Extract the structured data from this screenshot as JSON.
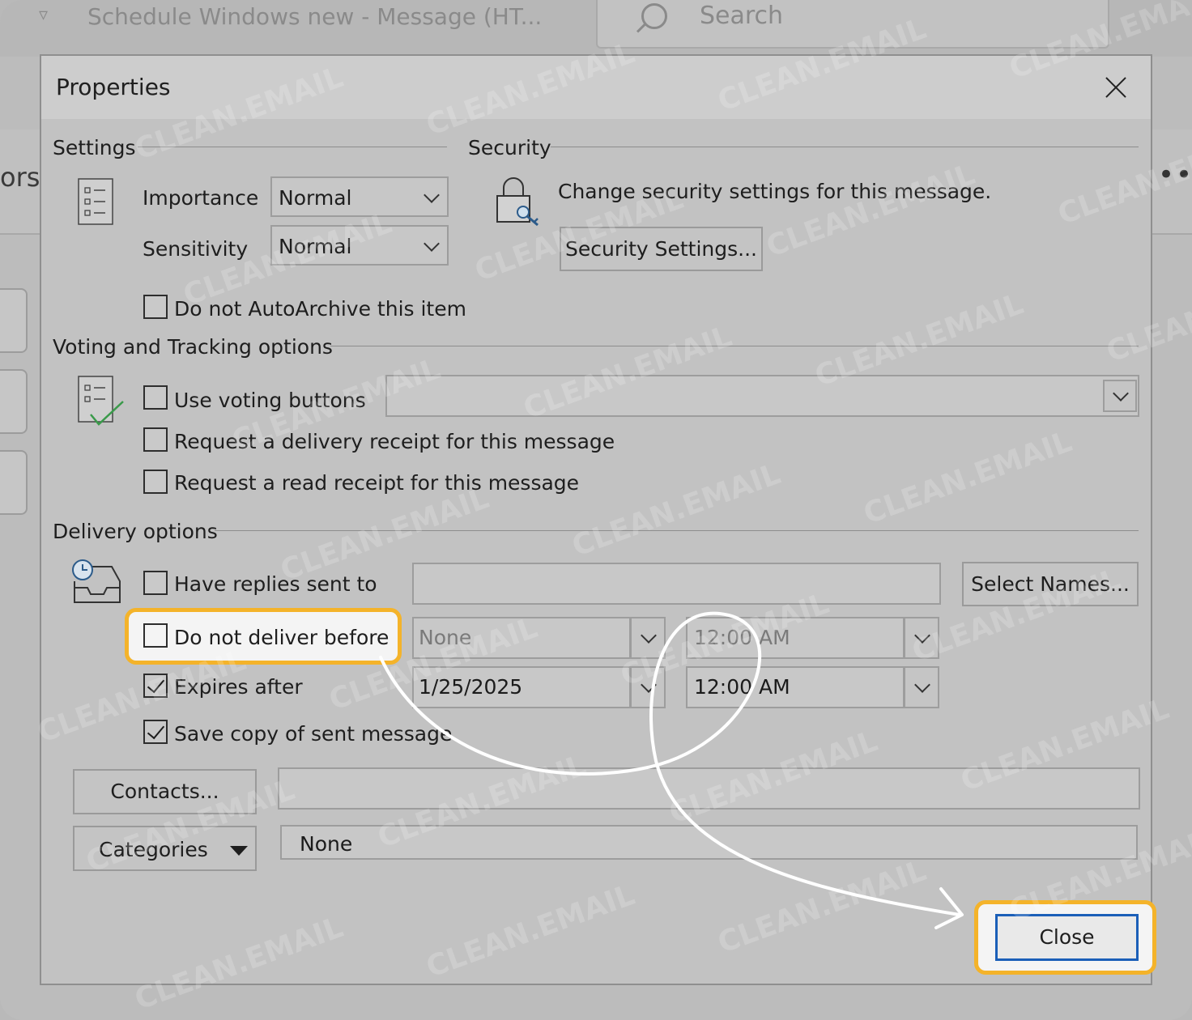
{
  "background": {
    "window_title": "Schedule Windows new  -  Message (HT...",
    "search_placeholder": "Search",
    "ribbon_fragment": "ors",
    "more_glyph": "••"
  },
  "dialog": {
    "title": "Properties",
    "settings": {
      "heading": "Settings",
      "importance_label": "Importance",
      "importance_value": "Normal",
      "sensitivity_label": "Sensitivity",
      "sensitivity_value": "Normal",
      "autoarchive_label": "Do not AutoArchive this item",
      "autoarchive_checked": false
    },
    "security": {
      "heading": "Security",
      "description": "Change security settings for this message.",
      "button_label": "Security Settings..."
    },
    "voting": {
      "heading": "Voting and Tracking options",
      "use_voting_label": "Use voting buttons",
      "delivery_receipt_label": "Request a delivery receipt for this message",
      "read_receipt_label": "Request a read receipt for this message"
    },
    "delivery": {
      "heading": "Delivery options",
      "replies_label": "Have replies sent to",
      "select_names_label": "Select Names...",
      "do_not_deliver_label": "Do not deliver before",
      "do_not_deliver_date": "None",
      "do_not_deliver_time": "12:00 AM",
      "expires_label": "Expires after",
      "expires_date": "1/25/2025",
      "expires_time": "12:00 AM",
      "save_copy_label": "Save copy of sent message"
    },
    "contacts_label": "Contacts...",
    "categories_label": "Categories",
    "categories_value": "None",
    "close_label": "Close"
  },
  "watermark_text": "CLEAN.EMAIL",
  "colors": {
    "highlight": "#f4b32a",
    "close_border": "#1b5fb8",
    "checkmark_green": "#3a9a4a"
  }
}
